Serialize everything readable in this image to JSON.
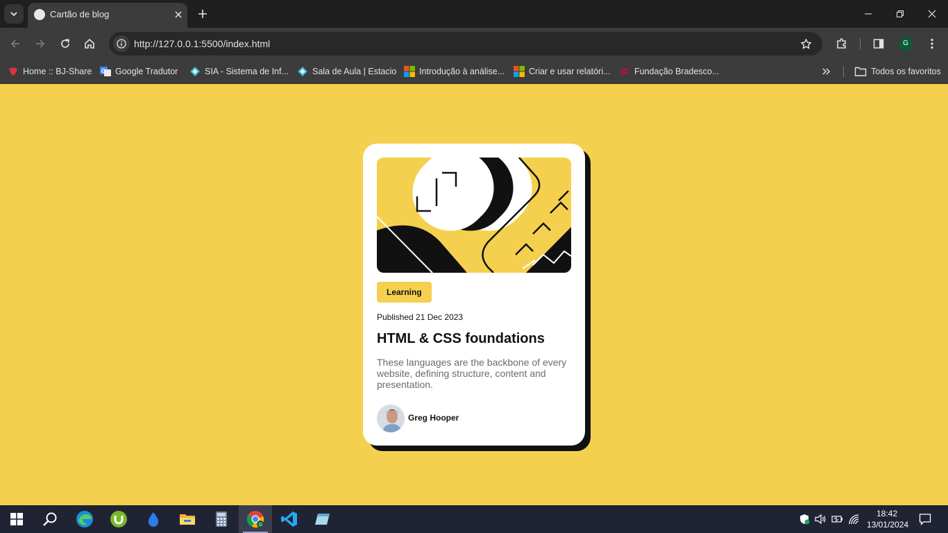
{
  "browser": {
    "tab_title": "Cartão de blog",
    "url": "http://127.0.0.1:5500/index.html",
    "profile_initial": "G",
    "bookmarks": [
      {
        "label": "Home :: BJ-Share",
        "icon": "bj-share-icon"
      },
      {
        "label": "Google Tradutor",
        "icon": "google-translate-icon"
      },
      {
        "label": "SIA - Sistema de Inf...",
        "icon": "sia-icon"
      },
      {
        "label": "Sala de Aula | Estacio",
        "icon": "estacio-icon"
      },
      {
        "label": "Introdução à análise...",
        "icon": "microsoft-icon"
      },
      {
        "label": "Criar e usar relatóri...",
        "icon": "microsoft-icon"
      },
      {
        "label": "Fundação Bradesco...",
        "icon": "bradesco-icon"
      }
    ],
    "all_bookmarks_label": "Todos os favoritos"
  },
  "card": {
    "tag": "Learning",
    "published": "Published 21 Dec 2023",
    "title": "HTML & CSS foundations",
    "description": "These languages are the backbone of every website, defining structure, content and presentation.",
    "author": "Greg Hooper"
  },
  "taskbar": {
    "apps": [
      "start-icon",
      "search-icon",
      "edge-icon",
      "utorrent-icon",
      "drop-icon",
      "file-explorer-icon",
      "calculator-icon",
      "chrome-icon",
      "vscode-icon",
      "notes-icon"
    ],
    "time": "18:42",
    "date": "13/01/2024"
  },
  "colors": {
    "page_background": "#f4d04e",
    "card_background": "#ffffff",
    "card_shadow": "#111111",
    "tag_background": "#f4d04e"
  }
}
